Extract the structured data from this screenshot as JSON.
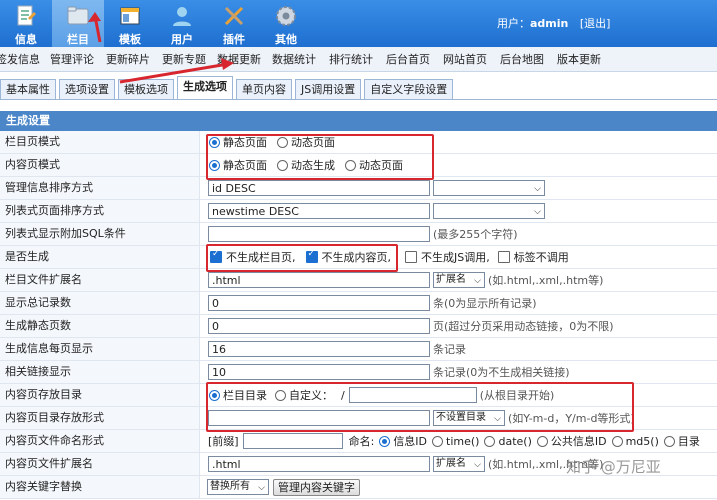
{
  "topnav": [
    {
      "label": "信息",
      "icon": "document-icon",
      "active": false
    },
    {
      "label": "栏目",
      "icon": "folder-icon",
      "active": true
    },
    {
      "label": "模板",
      "icon": "template-icon",
      "active": false
    },
    {
      "label": "用户",
      "icon": "user-icon",
      "active": false
    },
    {
      "label": "插件",
      "icon": "tools-icon",
      "active": false
    },
    {
      "label": "其他",
      "icon": "gear-icon",
      "active": false
    }
  ],
  "user": {
    "prefix": "用户：",
    "name": "admin",
    "logout": "[退出]"
  },
  "subnav": [
    "签发信息",
    "管理评论",
    "更新碎片",
    "更新专题",
    "数据更新",
    "数据统计",
    "排行统计",
    "后台首页",
    "网站首页",
    "后台地图",
    "版本更新"
  ],
  "tabs": [
    "基本属性",
    "选项设置",
    "模板选项",
    "生成选项",
    "单页内容",
    "JS调用设置",
    "自定义字段设置"
  ],
  "active_tab": "生成选项",
  "section_title": "生成设置",
  "rows": {
    "list_mode": {
      "label": "栏目页模式",
      "opt1": "静态页面",
      "opt2": "动态页面"
    },
    "content_mode": {
      "label": "内容页模式",
      "opt1": "静态页面",
      "opt2": "动态生成",
      "opt3": "动态页面"
    },
    "info_sort": {
      "label": "管理信息排序方式",
      "value": "id DESC"
    },
    "list_sort": {
      "label": "列表式页面排序方式",
      "value": "newstime DESC"
    },
    "list_sql": {
      "label": "列表式显示附加SQL条件",
      "value": "",
      "hint": "(最多255个字符)"
    },
    "gen": {
      "label": "是否生成",
      "c1": "不生成栏目页,",
      "c2": "不生成内容页,",
      "c3": "不生成JS调用,",
      "c4": "标签不调用"
    },
    "list_ext": {
      "label": "栏目文件扩展名",
      "value": ".html",
      "select": "扩展名",
      "hint": "(如.html,.xml,.htm等)"
    },
    "total": {
      "label": "显示总记录数",
      "value": "0",
      "hint": "条(0为显示所有记录)"
    },
    "static_pages": {
      "label": "生成静态页数",
      "value": "0",
      "hint": "页(超过分页采用动态链接，0为不限)"
    },
    "per_page": {
      "label": "生成信息每页显示",
      "value": "16",
      "hint": "条记录"
    },
    "related": {
      "label": "相关链接显示",
      "value": "10",
      "hint": "条记录(0为不生成相关链接)"
    },
    "content_dir": {
      "label": "内容页存放目录",
      "opt1": "栏目目录",
      "opt2": "自定义：",
      "slash": "/",
      "hint": "(从根目录开始)"
    },
    "content_dir_form": {
      "label": "内容页目录存放形式",
      "value": "",
      "select": "不设置目录",
      "hint": "(如Y-m-d，Y/m-d等形式)"
    },
    "content_naming": {
      "label": "内容页文件命名形式",
      "prefix_label": "[前缀]",
      "name_label": "命名:",
      "o1": "信息ID",
      "o2": "time()",
      "o3": "date()",
      "o4": "公共信息ID",
      "o5": "md5()",
      "o6": "目录"
    },
    "content_ext": {
      "label": "内容页文件扩展名",
      "value": ".html",
      "select": "扩展名",
      "hint": "(如.html,.xml,.htm等)"
    },
    "keyword": {
      "label": "内容关键字替换",
      "select": "替换所有",
      "button": "管理内容关键字"
    }
  },
  "watermark": "知乎 @万尼亚",
  "colors": {
    "topbar": "#1e6fd0",
    "section": "#4a86c8",
    "highlight": "#d8262e"
  }
}
